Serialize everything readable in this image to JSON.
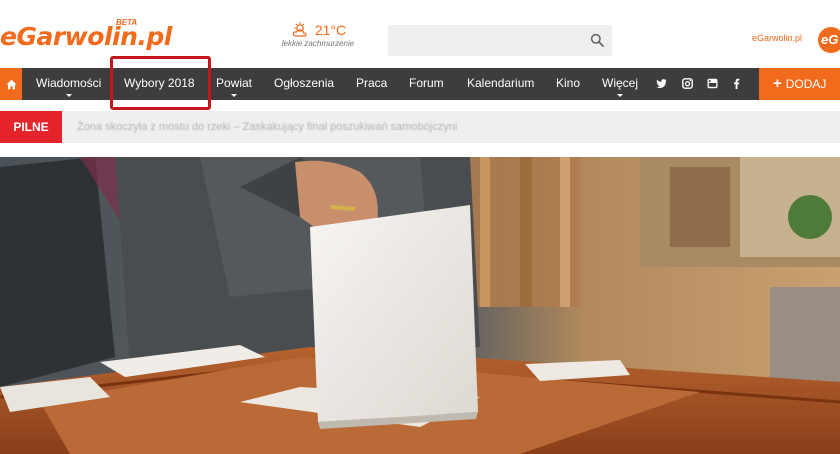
{
  "header": {
    "logo_prefix": "eGarwolin",
    "logo_suffix": ".pl",
    "logo_badge": "BETA",
    "weather_temp": "21°C",
    "weather_desc": "lekkie zachmurzenie",
    "weather_icon": "sun-cloud-icon",
    "search_placeholder": "",
    "site_link": "eGarwolin.pl",
    "site_badge_text": "eG"
  },
  "nav": {
    "items": [
      {
        "label": "Wiadomości",
        "has_dropdown": true
      },
      {
        "label": "Wybory 2018",
        "has_dropdown": false,
        "highlighted": true
      },
      {
        "label": "Powiat",
        "has_dropdown": true
      },
      {
        "label": "Ogłoszenia",
        "has_dropdown": false
      },
      {
        "label": "Praca",
        "has_dropdown": false
      },
      {
        "label": "Forum",
        "has_dropdown": false
      },
      {
        "label": "Kalendarium",
        "has_dropdown": false
      },
      {
        "label": "Kino",
        "has_dropdown": false
      },
      {
        "label": "Więcej",
        "has_dropdown": true
      }
    ],
    "social_icons": [
      "twitter-icon",
      "instagram-icon",
      "youtube-icon",
      "facebook-icon"
    ],
    "add_button": "DODAJ"
  },
  "ticker": {
    "badge": "PILNE",
    "headline": "Żona skoczyła z mostu do rzeki – Zaskakujący finał poszukiwań samobójczyni"
  },
  "colors": {
    "brand_orange": "#f26a1b",
    "nav_bg": "#3d3d3d",
    "pilne_red": "#e4232b",
    "highlight_red": "#c4161c"
  }
}
